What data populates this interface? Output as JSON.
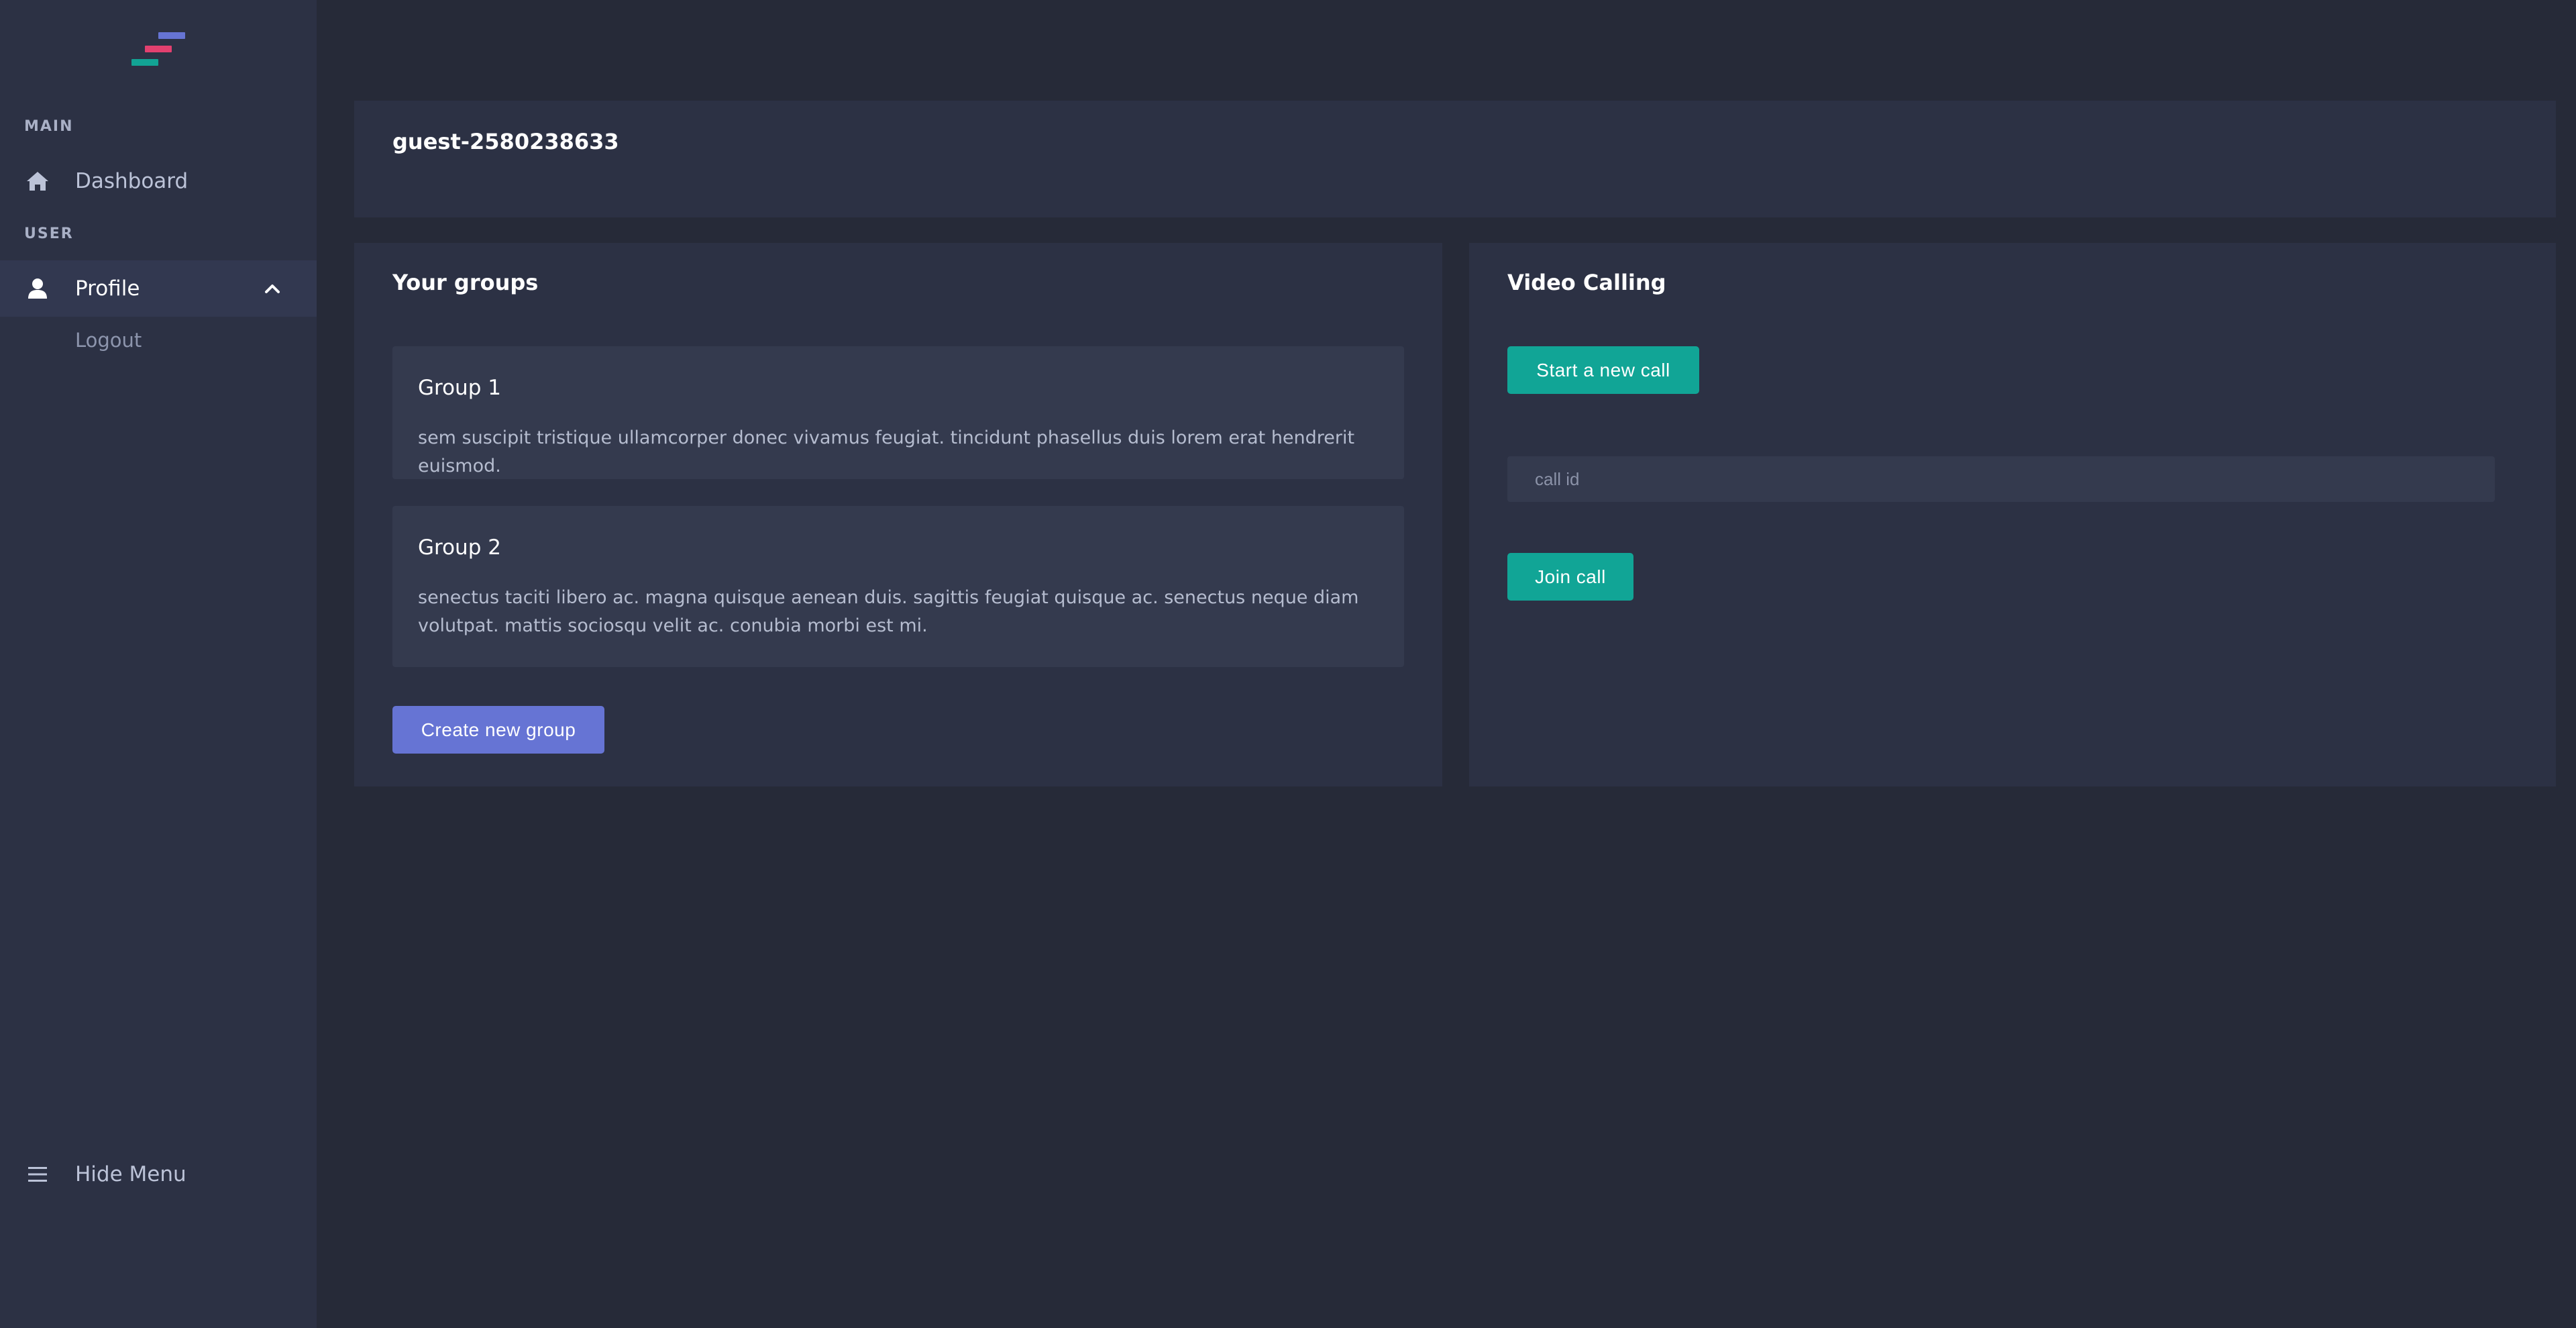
{
  "sidebar": {
    "logo": "app-logo",
    "sections": {
      "main_label": "MAIN",
      "user_label": "USER"
    },
    "items": [
      {
        "label": "Dashboard",
        "icon": "home-icon"
      },
      {
        "label": "Profile",
        "icon": "user-icon",
        "expanded": true,
        "children": [
          {
            "label": "Logout"
          }
        ]
      }
    ],
    "footer": {
      "label": "Hide Menu",
      "icon": "menu-icon"
    }
  },
  "user": {
    "name": "guest-2580238633"
  },
  "groups": {
    "title": "Your groups",
    "items": [
      {
        "name": "Group 1",
        "description": "sem suscipit tristique ullamcorper donec vivamus feugiat. tincidunt phasellus duis lorem erat hendrerit euismod."
      },
      {
        "name": "Group 2",
        "description": "senectus taciti libero ac. magna quisque aenean duis. sagittis feugiat quisque ac. senectus neque diam volutpat. mattis sociosqu velit ac. conubia morbi est mi."
      }
    ],
    "create_label": "Create new group"
  },
  "video": {
    "title": "Video Calling",
    "start_label": "Start a new call",
    "input_placeholder": "call id",
    "input_value": "",
    "join_label": "Join call"
  },
  "colors": {
    "background": "#262a38",
    "panel": "#2c3144",
    "accent": "#6674d4",
    "teal": "#11a596",
    "logo_red": "#e2406f"
  }
}
